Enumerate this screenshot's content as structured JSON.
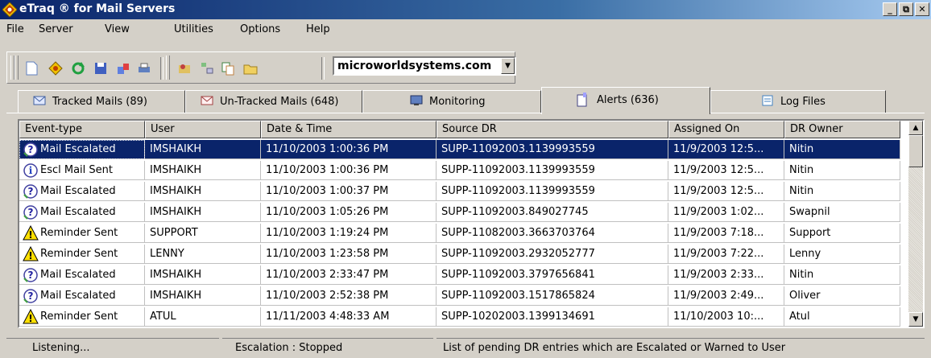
{
  "window": {
    "title": "eTraq ® for Mail Servers",
    "controls": {
      "minimize": "_",
      "maximize": "⧉",
      "close": "✕"
    }
  },
  "menu": [
    {
      "label": "File"
    },
    {
      "label": "Server"
    },
    {
      "label": "View"
    },
    {
      "label": "Utilities"
    },
    {
      "label": "Options"
    },
    {
      "label": "Help"
    }
  ],
  "toolbar": {
    "icons": [
      "new-icon",
      "etraq-icon",
      "refresh-icon",
      "save-icon",
      "export-icon",
      "print-icon",
      "import-icon",
      "tree-icon",
      "copy-icon",
      "open-folder-icon"
    ],
    "server_select": "microworldsystems.com"
  },
  "tabs": [
    {
      "label": "Tracked Mails (89)",
      "icon": "tracked-mail-icon"
    },
    {
      "label": "Un-Tracked Mails (648)",
      "icon": "untracked-mail-icon"
    },
    {
      "label": "Monitoring",
      "icon": "monitor-icon"
    },
    {
      "label": "Alerts (636)",
      "icon": "alert-doc-icon",
      "active": true
    },
    {
      "label": "Log Files",
      "icon": "log-file-icon"
    }
  ],
  "table": {
    "columns": [
      "Event-type",
      "User",
      "Date & Time",
      "Source DR",
      "Assigned On",
      "DR Owner"
    ],
    "rows": [
      {
        "event": "Mail Escalated",
        "icon": "question-escalate-icon",
        "user": "IMSHAIKH",
        "datetime": "11/10/2003 1:00:36 PM",
        "source_dr": "SUPP-11092003.1139993559",
        "assigned_on": "11/9/2003 12:5...",
        "owner": "Nitin",
        "selected": true
      },
      {
        "event": "Escl Mail Sent",
        "icon": "info-icon",
        "user": "IMSHAIKH",
        "datetime": "11/10/2003 1:00:36 PM",
        "source_dr": "SUPP-11092003.1139993559",
        "assigned_on": "11/9/2003 12:5...",
        "owner": "Nitin"
      },
      {
        "event": "Mail Escalated",
        "icon": "question-escalate-icon",
        "user": "IMSHAIKH",
        "datetime": "11/10/2003 1:00:37 PM",
        "source_dr": "SUPP-11092003.1139993559",
        "assigned_on": "11/9/2003 12:5...",
        "owner": "Nitin"
      },
      {
        "event": "Mail Escalated",
        "icon": "question-escalate-icon",
        "user": "IMSHAIKH",
        "datetime": "11/10/2003 1:05:26 PM",
        "source_dr": "SUPP-11092003.849027745",
        "assigned_on": "11/9/2003 1:02...",
        "owner": "Swapnil"
      },
      {
        "event": "Reminder Sent",
        "icon": "warning-icon",
        "user": "SUPPORT",
        "datetime": "11/10/2003 1:19:24 PM",
        "source_dr": "SUPP-11082003.3663703764",
        "assigned_on": "11/9/2003 7:18...",
        "owner": "Support"
      },
      {
        "event": "Reminder Sent",
        "icon": "warning-icon",
        "user": "LENNY",
        "datetime": "11/10/2003 1:23:58 PM",
        "source_dr": "SUPP-11092003.2932052777",
        "assigned_on": "11/9/2003 7:22...",
        "owner": "Lenny"
      },
      {
        "event": "Mail Escalated",
        "icon": "question-escalate-icon",
        "user": "IMSHAIKH",
        "datetime": "11/10/2003 2:33:47 PM",
        "source_dr": "SUPP-11092003.3797656841",
        "assigned_on": "11/9/2003 2:33...",
        "owner": "Nitin"
      },
      {
        "event": "Mail Escalated",
        "icon": "question-escalate-icon",
        "user": "IMSHAIKH",
        "datetime": "11/10/2003 2:52:38 PM",
        "source_dr": "SUPP-11092003.1517865824",
        "assigned_on": "11/9/2003 2:49...",
        "owner": "Oliver"
      },
      {
        "event": "Reminder Sent",
        "icon": "warning-icon",
        "user": "ATUL",
        "datetime": "11/11/2003 4:48:33 AM",
        "source_dr": "SUPP-10202003.1399134691",
        "assigned_on": "11/10/2003 10:...",
        "owner": "Atul"
      }
    ]
  },
  "status": {
    "listening": "Listening...",
    "escalation": "Escalation : Stopped",
    "message": "List of pending DR entries which are Escalated or Warned to User"
  },
  "colors": {
    "selection": "#0a246a",
    "title_start": "#0a246a",
    "face": "#d4d0c8"
  }
}
